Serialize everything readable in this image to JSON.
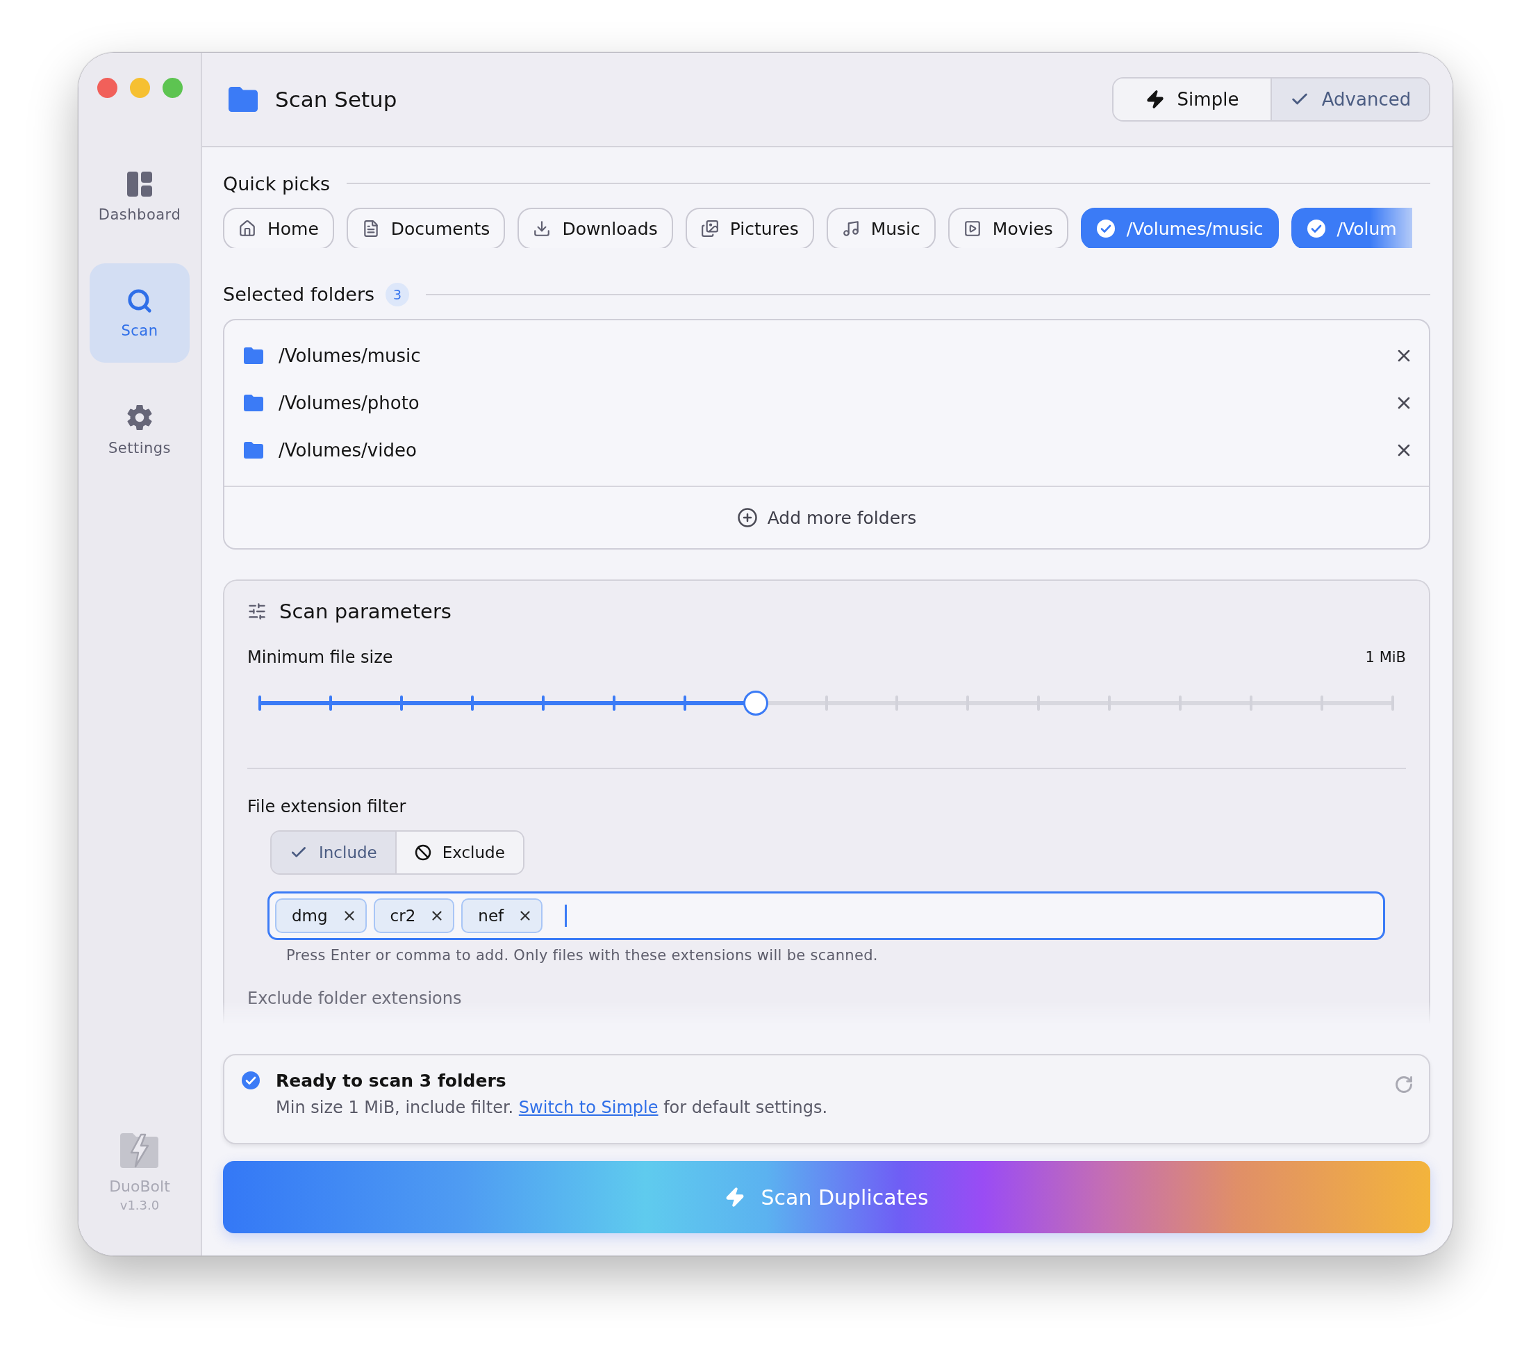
{
  "window": {
    "title": "Scan Setup"
  },
  "sidebar": {
    "items": [
      {
        "label": "Dashboard",
        "kind": "dashboard",
        "selected": false
      },
      {
        "label": "Scan",
        "kind": "scan",
        "selected": true
      },
      {
        "label": "Settings",
        "kind": "settings",
        "selected": false
      }
    ],
    "app_name": "DuoBolt",
    "version": "v1.3.0"
  },
  "mode_switch": [
    {
      "label": "Simple",
      "kind": "bolt",
      "selected": false
    },
    {
      "label": "Advanced",
      "kind": "check",
      "selected": true
    }
  ],
  "quick_picks": {
    "title": "Quick picks",
    "items": [
      {
        "label": "Home",
        "kind": "home",
        "selected": false
      },
      {
        "label": "Documents",
        "kind": "document",
        "selected": false
      },
      {
        "label": "Downloads",
        "kind": "download",
        "selected": false
      },
      {
        "label": "Pictures",
        "kind": "pictures",
        "selected": false
      },
      {
        "label": "Music",
        "kind": "music",
        "selected": false
      },
      {
        "label": "Movies",
        "kind": "movies",
        "selected": false
      },
      {
        "label": "/Volumes/music",
        "kind": "volume",
        "selected": true
      },
      {
        "label": "/Volum",
        "kind": "volume",
        "selected": true
      }
    ]
  },
  "selected_folders": {
    "title": "Selected folders",
    "count": "3",
    "items": [
      {
        "path": "/Volumes/music"
      },
      {
        "path": "/Volumes/photo"
      },
      {
        "path": "/Volumes/video"
      }
    ],
    "add_label": "Add more folders"
  },
  "scan_parameters": {
    "title": "Scan parameters",
    "min_size": {
      "label": "Minimum file size",
      "reading": "1 MiB",
      "level": 0.4375
    },
    "extension_filter": {
      "label": "File extension filter",
      "modes": [
        {
          "label": "Include",
          "kind": "include",
          "selected": true
        },
        {
          "label": "Exclude",
          "kind": "exclude",
          "selected": false
        }
      ],
      "tags": [
        "dmg",
        "cr2",
        "nef"
      ],
      "hint": "Press Enter or comma to add. Only files with these extensions will be scanned."
    },
    "exclude_folders": {
      "label": "Exclude folder extensions"
    }
  },
  "status": {
    "title": "Ready to scan 3 folders",
    "detail_start": "Min size 1 MiB, include filter. ",
    "link": "Switch to Simple",
    "detail_end": " for default settings."
  },
  "scan_button": {
    "label": "Scan Duplicates"
  }
}
